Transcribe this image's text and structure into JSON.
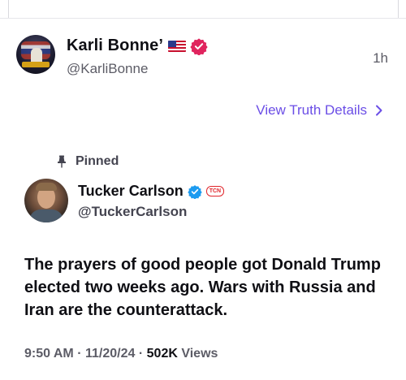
{
  "post": {
    "display_name": "Karli Bonne’",
    "handle": "@KarliBonne",
    "time": "1h",
    "view_details_label": "View Truth Details",
    "avatar_icon": "karli-avatar",
    "flag_icon": "us-flag-icon",
    "verified_icon": "verified-badge-pink",
    "colors": {
      "accent": "#6b4ee6",
      "verified": "#e0245e"
    }
  },
  "quoted": {
    "pinned_label": "Pinned",
    "display_name": "Tucker Carlson",
    "handle": "@TuckerCarlson",
    "badge_text": "TCN",
    "text": "The prayers of good people got Donald Trump elected two weeks ago. Wars with Russia and Iran are the counterattack.",
    "meta_time": "9:50 AM",
    "meta_date": "11/20/24",
    "views_count": "502K",
    "views_label": "Views",
    "colors": {
      "verified": "#1d9bf0",
      "badge": "#e0252b"
    }
  }
}
